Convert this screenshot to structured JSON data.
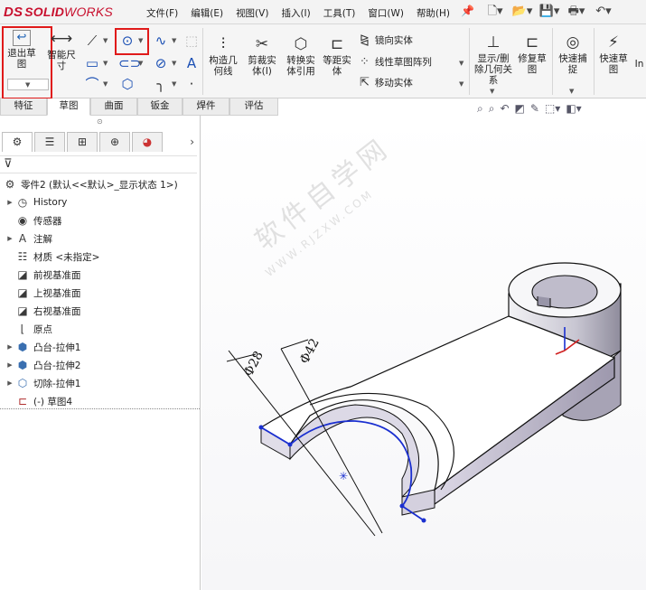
{
  "app": {
    "logo_ds": "DS",
    "logo_solid": "SOLID",
    "logo_works": "WORKS"
  },
  "menu": [
    "文件(F)",
    "编辑(E)",
    "视图(V)",
    "插入(I)",
    "工具(T)",
    "窗口(W)",
    "帮助(H)"
  ],
  "quick_access": {
    "icons": [
      "new-document-icon",
      "open-folder-icon",
      "save-icon",
      "print-icon",
      "undo-icon"
    ]
  },
  "ribbon": {
    "exit_sketch": "退出草图",
    "smart_dimension": "智能尺寸",
    "construction_geometry": "构造几何线",
    "trim_entities": "剪裁实体(I)",
    "convert_entities": "转换实体引用",
    "offset_entities": "等距实体",
    "mirror_entities": "镜向实体",
    "linear_pattern": "线性草图阵列",
    "move_entities": "移动实体",
    "display_relations": "显示/删除几何关系",
    "repair_sketch": "修复草图",
    "quick_snaps": "快速捕捉",
    "rapid_sketch": "快速草图",
    "overflow": "In"
  },
  "tabs": [
    {
      "label": "特征",
      "active": false
    },
    {
      "label": "草图",
      "active": true
    },
    {
      "label": "曲面",
      "active": false
    },
    {
      "label": "钣金",
      "active": false
    },
    {
      "label": "焊件",
      "active": false
    },
    {
      "label": "评估",
      "active": false
    }
  ],
  "feature_tree": {
    "root": "零件2 (默认<<默认>_显示状态 1>)",
    "items": [
      {
        "label": "History",
        "expandable": true,
        "icon": "history-icon"
      },
      {
        "label": "传感器",
        "expandable": false,
        "icon": "sensor-icon"
      },
      {
        "label": "注解",
        "expandable": true,
        "icon": "annotation-icon"
      },
      {
        "label": "材质 <未指定>",
        "expandable": false,
        "icon": "material-icon"
      },
      {
        "label": "前视基准面",
        "expandable": false,
        "icon": "plane-icon"
      },
      {
        "label": "上视基准面",
        "expandable": false,
        "icon": "plane-icon"
      },
      {
        "label": "右视基准面",
        "expandable": false,
        "icon": "plane-icon"
      },
      {
        "label": "原点",
        "expandable": false,
        "icon": "origin-icon"
      },
      {
        "label": "凸台-拉伸1",
        "expandable": true,
        "icon": "boss-extrude-icon"
      },
      {
        "label": "凸台-拉伸2",
        "expandable": true,
        "icon": "boss-extrude-icon"
      },
      {
        "label": "切除-拉伸1",
        "expandable": true,
        "icon": "cut-extrude-icon"
      },
      {
        "label": "(-) 草图4",
        "expandable": false,
        "icon": "sketch-icon"
      }
    ]
  },
  "graphics": {
    "dim_phi42": "Φ42",
    "dim_phi28": "Φ28",
    "watermark_cn": "软件自学网",
    "watermark_en": "WWW.RJZXW.COM",
    "sketch_color": "#1a2fd0",
    "highlight_color": "#e01a1a"
  }
}
